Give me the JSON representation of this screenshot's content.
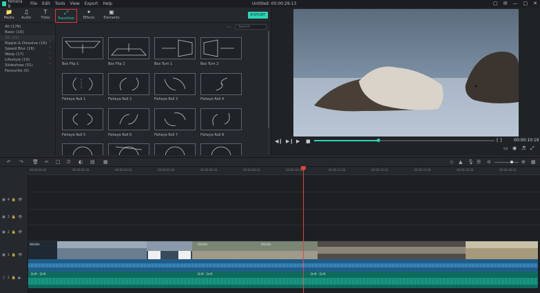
{
  "app": {
    "logo_text": "filmora 9",
    "menu": [
      "File",
      "Edit",
      "Tools",
      "View",
      "Export",
      "Help"
    ],
    "window_title": "Untitled: 00:00:29:13",
    "window_controls": [
      "▢",
      "✉",
      "—",
      "□",
      "✕"
    ]
  },
  "tabs": [
    {
      "label": "Media",
      "icon": "folder-icon"
    },
    {
      "label": "Audio",
      "icon": "music-icon"
    },
    {
      "label": "Titles",
      "icon": "text-icon"
    },
    {
      "label": "Transition",
      "icon": "transition-icon",
      "active": true
    },
    {
      "label": "Effects",
      "icon": "effects-icon"
    },
    {
      "label": "Elements",
      "icon": "image-icon"
    }
  ],
  "export_label": "EXPORT",
  "sidebar": {
    "items": [
      {
        "label": "All (178)"
      },
      {
        "label": "Basic (10)"
      },
      {
        "label": "3D (32)",
        "selected": true
      },
      {
        "label": "Ripple & Dissolve (16)",
        "expand": true
      },
      {
        "label": "Speed Blur (16)",
        "expand": true
      },
      {
        "label": "Warp (17)",
        "expand": true
      },
      {
        "label": "Lifestyle (19)",
        "expand": true
      },
      {
        "label": "Slideshow (31)",
        "expand": true
      },
      {
        "label": "Favourite (0)"
      }
    ]
  },
  "library": {
    "search_placeholder": "Search",
    "transitions": [
      "Box Flip 1",
      "Box Flip 2",
      "Box Turn 1",
      "Box Turn 2",
      "Fisheye Roll 1",
      "Fisheye Roll 2",
      "Fisheye Roll 3",
      "Fisheye Roll 4",
      "Fisheye Roll 5",
      "Fisheye Roll 6",
      "Fisheye Roll 7",
      "Fisheye Roll 8",
      "",
      "",
      "",
      ""
    ]
  },
  "preview": {
    "timecode": "00:00:10:19",
    "progress": 0.355,
    "brackets": "{    }"
  },
  "ruler": {
    "ticks": [
      "00:00:00:00",
      "00:00:01:20",
      "00:00:03:10",
      "00:00:05:00",
      "00:00:06:20",
      "00:00:08:10",
      "00:00:10:00",
      "00:00:11:20",
      "00:00:13:10",
      "00:00:15:00",
      "00:00:16:20",
      "00:00:18:10",
      "00:00:20:00",
      "00:00:21:20"
    ]
  },
  "tracks": {
    "heads": [
      "4",
      "3",
      "2",
      "1",
      "1"
    ],
    "video_labels": [
      "Wildlife",
      "Wildlife",
      "Wildlife"
    ],
    "audio_labels": [
      "Drift - Drift",
      "Drift - Drift",
      "Drift - Drift"
    ]
  },
  "colors": {
    "accent": "#2fd3b6",
    "playhead": "#e0453e",
    "active_tab_border": "#e23a3a"
  }
}
